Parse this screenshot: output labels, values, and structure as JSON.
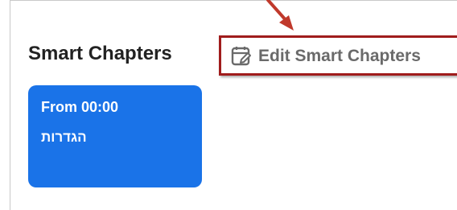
{
  "section": {
    "title": "Smart Chapters",
    "edit_button_label": "Edit Smart Chapters",
    "edit_icon": "edit-chapters-icon"
  },
  "chapters": [
    {
      "time_label": "From 00:00",
      "name": "הגדרות"
    }
  ],
  "colors": {
    "chapter_card": "#1a73e8",
    "highlight_box": "#a01c1c",
    "annotation_arrow": "#c0392b"
  }
}
